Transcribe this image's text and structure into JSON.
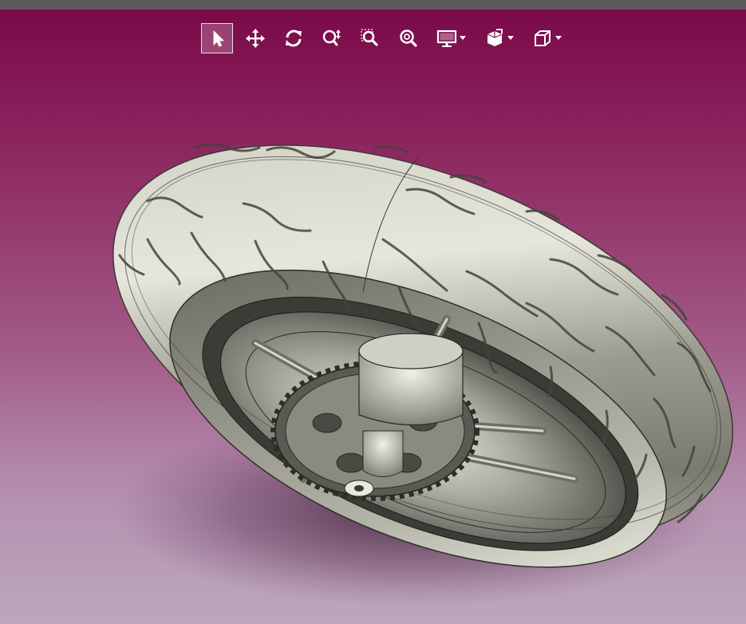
{
  "app": {
    "window_strip_color": "#5a5a5c",
    "viewport_gradient": [
      "#7a0a48",
      "#bca7bd"
    ]
  },
  "toolbar": {
    "buttons": [
      {
        "id": "select",
        "icon": "cursor-arrow-icon",
        "active": true
      },
      {
        "id": "pan",
        "icon": "move-arrows-icon",
        "active": false
      },
      {
        "id": "rotate",
        "icon": "rotate-icon",
        "active": false
      },
      {
        "id": "zoom-dynamic",
        "icon": "zoom-dynamic-icon",
        "active": false
      },
      {
        "id": "zoom-area",
        "icon": "zoom-area-icon",
        "active": false
      },
      {
        "id": "zoom-fit",
        "icon": "zoom-fit-icon",
        "active": false
      },
      {
        "id": "display-mode",
        "icon": "monitor-icon",
        "active": false,
        "has_dropdown": true
      },
      {
        "id": "view-orientation",
        "icon": "view-orient-icon",
        "active": false,
        "has_dropdown": true
      },
      {
        "id": "standard-views",
        "icon": "cube-icon",
        "active": false,
        "has_dropdown": true
      }
    ]
  },
  "model": {
    "object": "motorcycle-rear-wheel-with-sprocket",
    "material_color": "#a8a89c"
  }
}
